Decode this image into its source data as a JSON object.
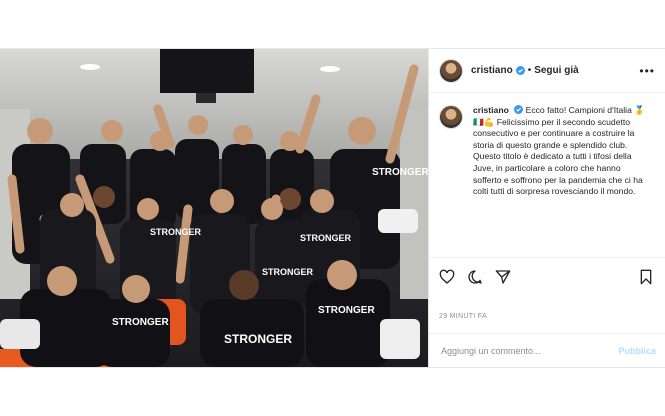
{
  "post": {
    "username": "cristiano",
    "verified": true,
    "separator": "•",
    "follow_label": "Segui già",
    "more_label": "•••"
  },
  "caption": {
    "username": "cristiano",
    "text": "Ecco fatto! Campioni d'Italia 🥇🇮🇹💪 Felicissimo per il secondo scudetto consecutivo e per continuare a costruire la storia di questo grande e splendido club. Questo titolo è dedicato a tutti i tifosi della Juve, in particolare a coloro che hanno sofferto e soffrono per la pandemia che ci ha colti tutti di sorpresa rovesciando il mondo."
  },
  "photo": {
    "jersey_text": "STRONGER"
  },
  "actions": {
    "like": "heart-icon",
    "comment": "comment-icon",
    "share": "share-icon",
    "save": "bookmark-icon"
  },
  "timestamp": "29 MINUTI FA",
  "comment_box": {
    "placeholder": "Aggiungi un commento...",
    "publish_label": "Pubblica"
  },
  "colors": {
    "verified_blue": "#3897f0",
    "publish_disabled": "#b2dffc",
    "text": "#262626",
    "muted": "#8e8e8e"
  }
}
